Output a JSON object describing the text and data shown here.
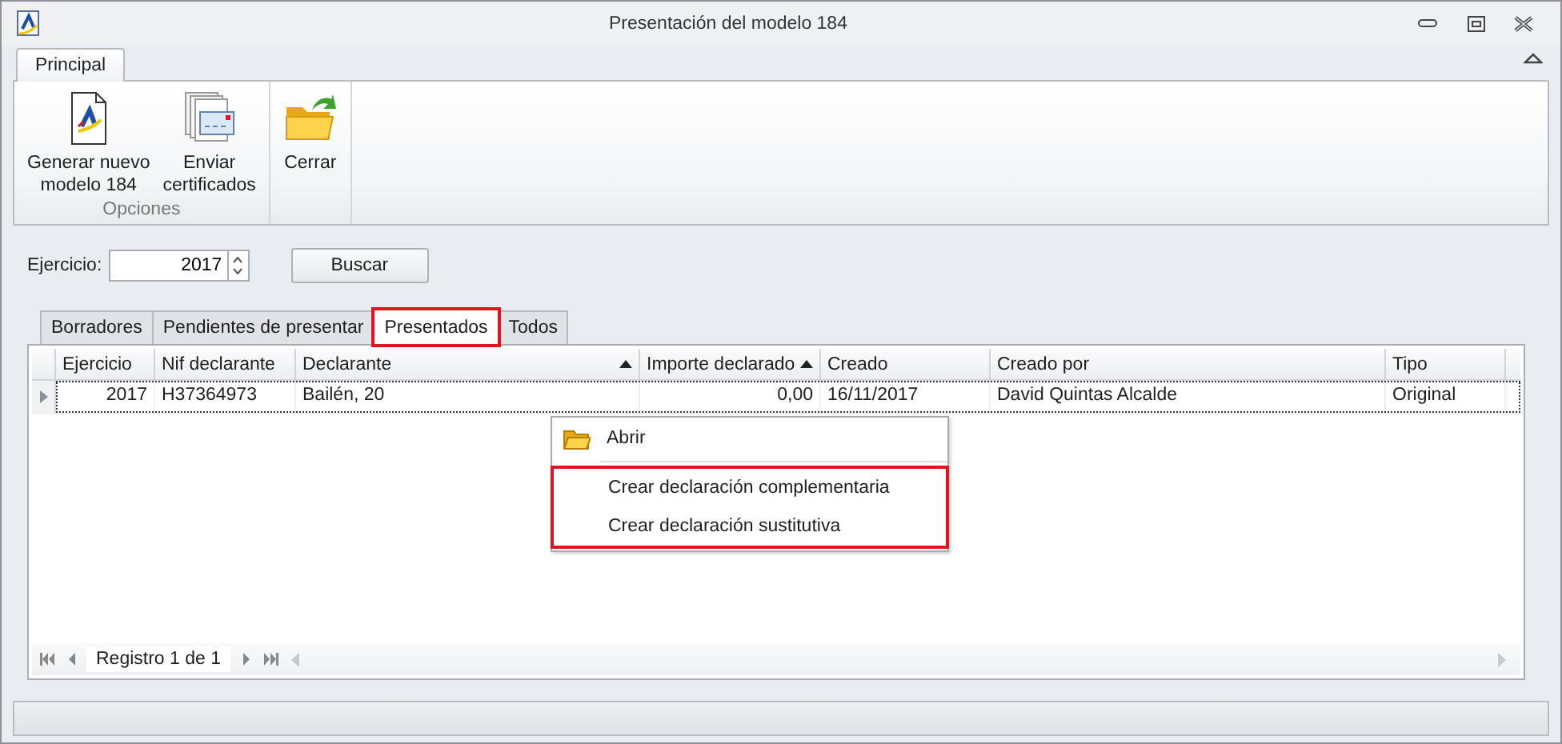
{
  "window": {
    "title": "Presentación del modelo 184"
  },
  "ribbon": {
    "tabs": [
      {
        "label": "Principal",
        "selected": true
      }
    ],
    "groups": [
      {
        "label": "Opciones",
        "buttons": [
          {
            "label": "Generar nuevo\nmodelo 184"
          },
          {
            "label": "Enviar\ncertificados"
          }
        ]
      },
      {
        "buttons": [
          {
            "label": "Cerrar"
          }
        ]
      }
    ]
  },
  "filter": {
    "label": "Ejercicio:",
    "value": "2017",
    "button": "Buscar"
  },
  "tabs": [
    {
      "label": "Borradores",
      "selected": false,
      "highlighted": false
    },
    {
      "label": "Pendientes de presentar",
      "selected": false,
      "highlighted": false
    },
    {
      "label": "Presentados",
      "selected": true,
      "highlighted": true
    },
    {
      "label": "Todos",
      "selected": false,
      "highlighted": false
    }
  ],
  "table": {
    "columns": [
      {
        "label": "Ejercicio",
        "sorted": false
      },
      {
        "label": "Nif declarante",
        "sorted": false
      },
      {
        "label": "Declarante",
        "sorted": true
      },
      {
        "label": "Importe declarado",
        "sorted": true
      },
      {
        "label": "Creado",
        "sorted": false
      },
      {
        "label": "Creado por",
        "sorted": false
      },
      {
        "label": "Tipo",
        "sorted": false
      }
    ],
    "rows": [
      {
        "selected": true,
        "cells": [
          "2017",
          "H37364973",
          "Bailén, 20",
          "0,00",
          "16/11/2017",
          "David Quintas Alcalde",
          "Original"
        ]
      }
    ]
  },
  "context_menu": {
    "items": [
      {
        "label": "Abrir",
        "highlighted": false
      },
      {
        "label": "Crear declaración complementaria",
        "highlighted": true
      },
      {
        "label": "Crear declaración sustitutiva",
        "highlighted": true
      }
    ]
  },
  "pager": {
    "text": "Registro 1 de 1"
  }
}
